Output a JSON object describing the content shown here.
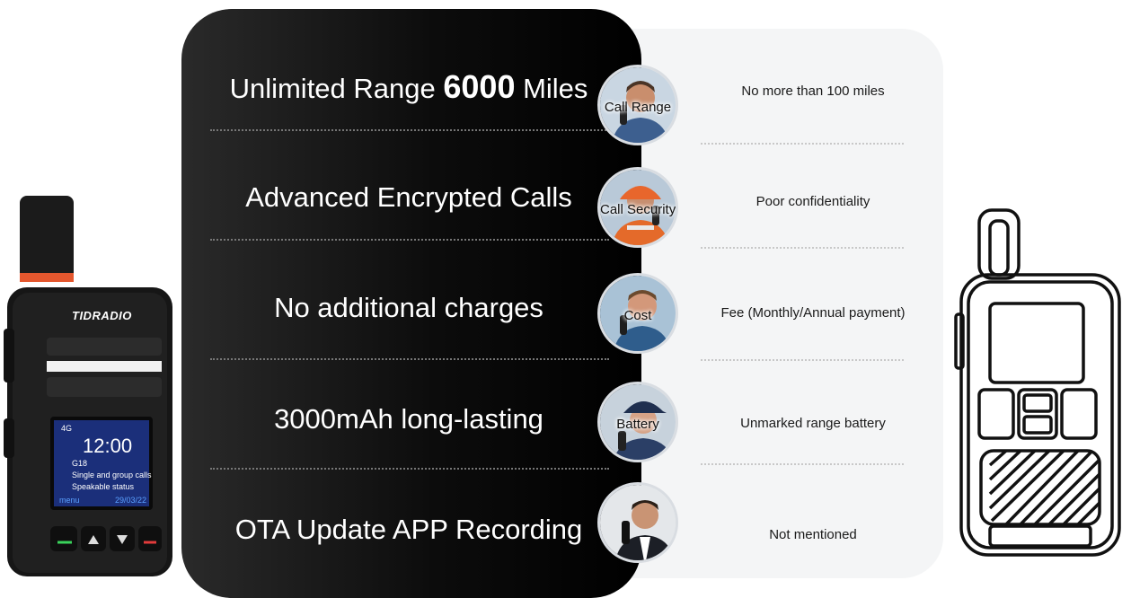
{
  "features": [
    {
      "advantage_prefix": "Unlimited Range ",
      "advantage_bold": "6000",
      "advantage_suffix": " Miles",
      "badge_label": "Call Range",
      "competitor": "No more than 100 miles"
    },
    {
      "advantage_prefix": "Advanced Encrypted Calls",
      "advantage_bold": "",
      "advantage_suffix": "",
      "badge_label": "Call Security",
      "competitor": "Poor confidentiality"
    },
    {
      "advantage_prefix": "No additional charges",
      "advantage_bold": "",
      "advantage_suffix": "",
      "badge_label": "Cost",
      "competitor": "Fee (Monthly/Annual payment)"
    },
    {
      "advantage_prefix": "3000mAh long-lasting",
      "advantage_bold": "",
      "advantage_suffix": "",
      "badge_label": "Battery",
      "competitor": "Unmarked range battery"
    },
    {
      "advantage_prefix": "OTA Update APP Recording",
      "advantage_bold": "",
      "advantage_suffix": "",
      "badge_label": "",
      "competitor": "Not mentioned"
    }
  ],
  "product": {
    "brand": "TIDRADIO",
    "screen": {
      "status": "4G",
      "time": "12:00",
      "group": "G18",
      "line1": "Single and group calls",
      "line2": "Speakable status",
      "softkey_left": "menu",
      "softkey_right": "29/03/22"
    }
  },
  "colors": {
    "dark_panel": "#000000",
    "light_panel": "#f4f5f6",
    "accent_orange": "#e4572e",
    "screen_bg": "#1b2f7a"
  },
  "icons": [
    "call-range-photo-icon",
    "call-security-photo-icon",
    "cost-photo-icon",
    "battery-photo-icon",
    "ota-photo-icon"
  ]
}
